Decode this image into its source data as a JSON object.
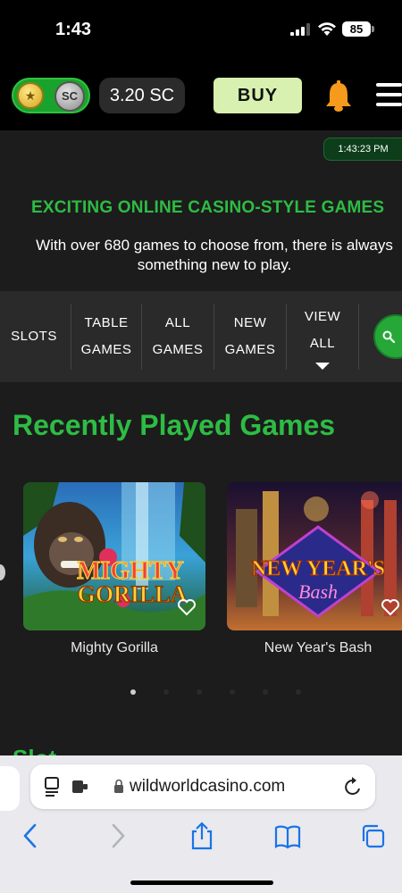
{
  "status": {
    "time": "1:43",
    "battery": "85"
  },
  "header": {
    "coin_gc_icon": "star-coin-icon",
    "coin_sc_label": "SC",
    "balance": "3.20 SC",
    "buy_label": "BUY",
    "bell_icon": "bell-icon",
    "menu_icon": "hamburger-menu-icon"
  },
  "clock_badge": "1:43:23 PM",
  "hero": {
    "headline": "EXCITING ONLINE CASINO-STYLE GAMES",
    "subtext": "With over 680 games to choose from, there is always something new to play."
  },
  "categories": {
    "slots": "SLOTS",
    "table_line1": "TABLE",
    "table_line2": "GAMES",
    "all_line1": "ALL",
    "all_line2": "GAMES",
    "new_line1": "NEW",
    "new_line2": "GAMES",
    "view_line1": "VIEW",
    "view_line2": "ALL"
  },
  "recent": {
    "title": "Recently Played Games",
    "games": [
      {
        "name": "Mighty Gorilla",
        "art_line1": "MIGHTY",
        "art_line2": "GORILLA"
      },
      {
        "name": "New Year's Bash",
        "art_line1": "NEW YEAR'S",
        "art_line2": "Bash"
      }
    ],
    "pager_total": 6,
    "pager_active": 1
  },
  "next_section_peek": "Slot",
  "browser": {
    "url": "wildworldcasino.com"
  },
  "colors": {
    "accent_green": "#2ebc44",
    "buy_bg": "#d8f0b0",
    "content_bg": "#1c1c1c",
    "bar_bg": "#2a2a2a"
  }
}
